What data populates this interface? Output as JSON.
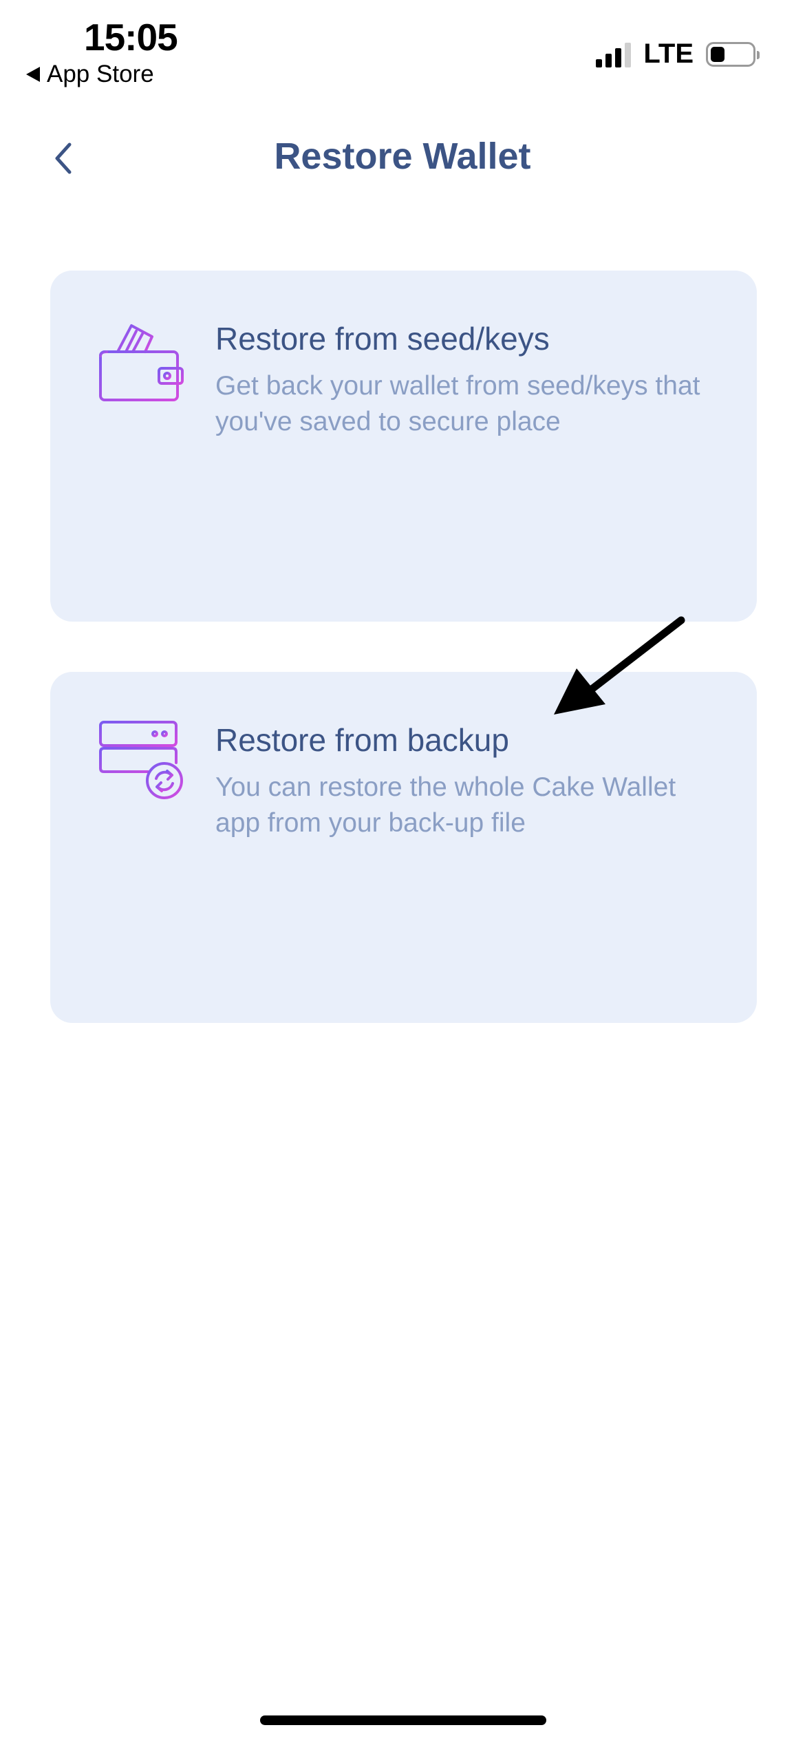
{
  "status_bar": {
    "time": "15:05",
    "back_app_label": "App Store",
    "network_label": "LTE",
    "signal_icon": "cellular-signal-icon",
    "battery_icon": "battery-icon"
  },
  "header": {
    "title": "Restore Wallet",
    "back_icon": "chevron-left-icon"
  },
  "options": [
    {
      "title": "Restore from seed/keys",
      "description": "Get back your wallet from seed/keys that you've saved to secure place",
      "icon": "wallet-icon"
    },
    {
      "title": "Restore from backup",
      "description": "You can restore the whole Cake Wallet app from your back-up file",
      "icon": "server-restore-icon"
    }
  ],
  "colors": {
    "title": "#3c5485",
    "card_background": "#e9effa",
    "description": "#8a9ec4",
    "icon_gradient_start": "#7b5cf0",
    "icon_gradient_end": "#d24be0"
  }
}
